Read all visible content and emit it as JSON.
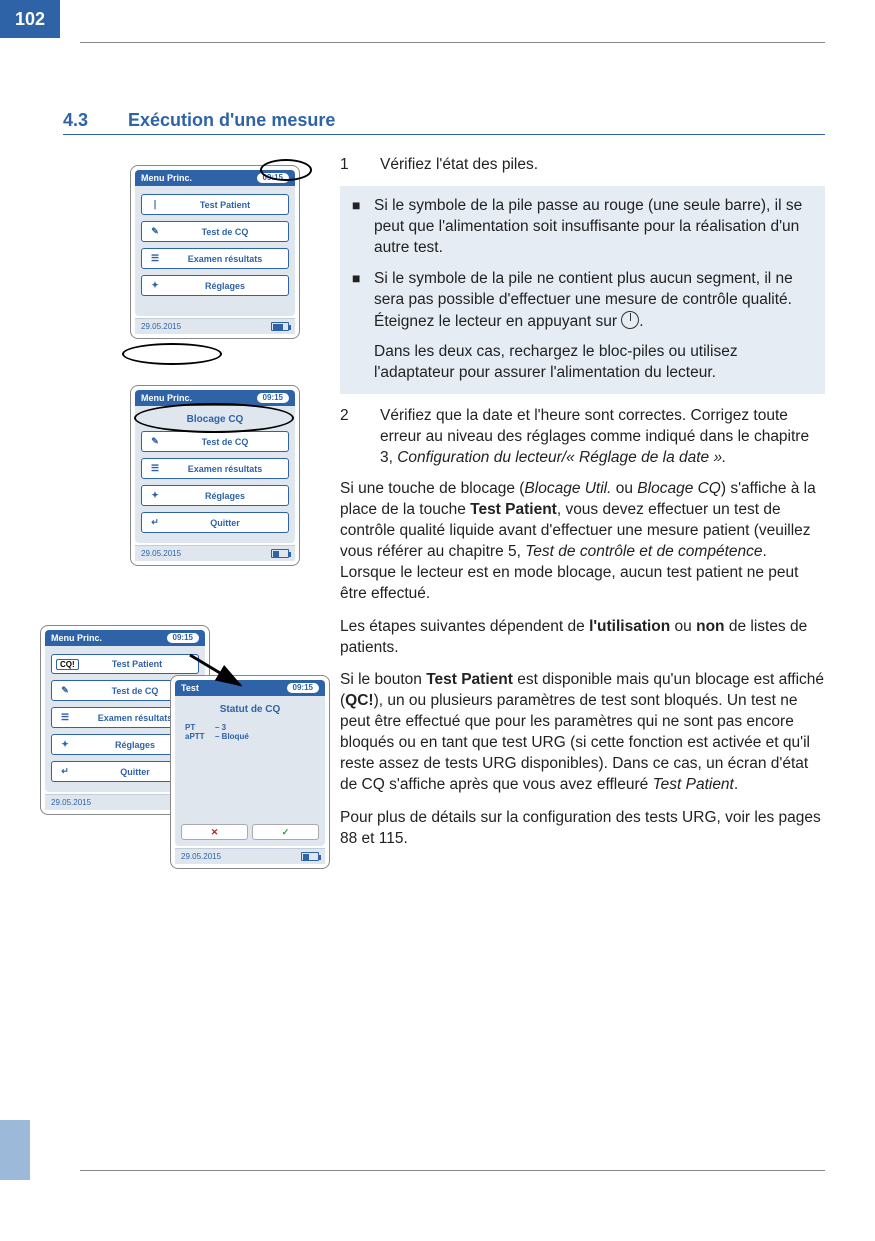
{
  "page_number": "102",
  "heading_number": "4.3",
  "heading_title": "Exécution d'une mesure",
  "step1_num": "1",
  "step1_text": "Vérifiez l'état des piles.",
  "note_item1": "Si le symbole de la pile passe au rouge (une seule barre), il se peut que l'alimentation soit insuffisante pour la réalisation d'un autre test.",
  "note_item2a": "Si le symbole de la pile ne contient plus aucun segment, il ne sera pas possible d'effectuer une mesure de contrôle qualité. Éteignez le lecteur en appuyant sur ",
  "note_item2b": ".",
  "note_tail": "Dans les deux cas, rechargez le bloc-piles ou utilisez l'adaptateur pour assurer l'alimentation du lecteur.",
  "step2_num": "2",
  "step2_text_a": "Vérifiez que la date et l'heure sont correctes. Corrigez toute erreur au niveau des réglages comme indiqué dans le chapitre 3, ",
  "step2_text_b_italic": "Configuration du lecteur/« Réglage de la date ».",
  "para1_a": "Si une touche de blocage (",
  "para1_b_italic": "Blocage Util.",
  "para1_c": " ou ",
  "para1_d_italic": "Blocage CQ",
  "para1_e": ") s'affiche à la place de la touche ",
  "para1_f_bold": "Test Patient",
  "para1_g": ", vous devez effectuer un test de contrôle qualité liquide avant d'effectuer une mesure patient (veuillez vous référer au chapitre 5, ",
  "para1_h_italic": "Test de contrôle et de compétence",
  "para1_i": ". Lorsque le lecteur est en mode blocage, aucun test patient ne peut être effectué.",
  "para2_a": "Les étapes suivantes dépendent de ",
  "para2_b_bold": "l'utilisation",
  "para2_c": " ou ",
  "para2_d_bold": "non",
  "para2_e": " de listes de patients.",
  "para3_a": "Si le bouton ",
  "para3_b_bold": "Test Patient",
  "para3_c": " est disponible mais qu'un blocage est affiché (",
  "para3_d_bold": "QC!",
  "para3_e": "), un ou plusieurs paramètres de test sont bloqués. Un test ne peut être effectué que pour les paramètres qui ne sont pas encore bloqués ou en tant que test URG (si cette fonction est activée et qu'il reste assez de tests URG disponibles). Dans ce cas, un écran d'état de CQ s'affiche après que vous avez effleuré ",
  "para3_f_italic": "Test Patient",
  "para3_g": ".",
  "para4": "Pour plus de détails sur la configuration des tests URG, voir les pages 88 et 115.",
  "dev_common": {
    "header": "Menu Princ.",
    "time": "09:15",
    "date": "29.05.2015"
  },
  "dev1": {
    "btn1": "Test Patient",
    "btn2": "Test de CQ",
    "btn3": "Examen résultats",
    "btn4": "Réglages"
  },
  "dev2": {
    "title": "Blocage CQ",
    "btn1": "Test de CQ",
    "btn2": "Examen résultats",
    "btn3": "Réglages",
    "btn4": "Quitter"
  },
  "dev3": {
    "cq_badge": "CQ!",
    "btn1": "Test Patient",
    "btn2": "Test de CQ",
    "btn3": "Examen résultats",
    "btn4": "Réglages",
    "btn5": "Quitter"
  },
  "dev4": {
    "header": "Test",
    "title": "Statut de CQ",
    "p1_name": "PT",
    "p1_val": "– 3",
    "p2_name": "aPTT",
    "p2_val": "– Bloqué"
  }
}
